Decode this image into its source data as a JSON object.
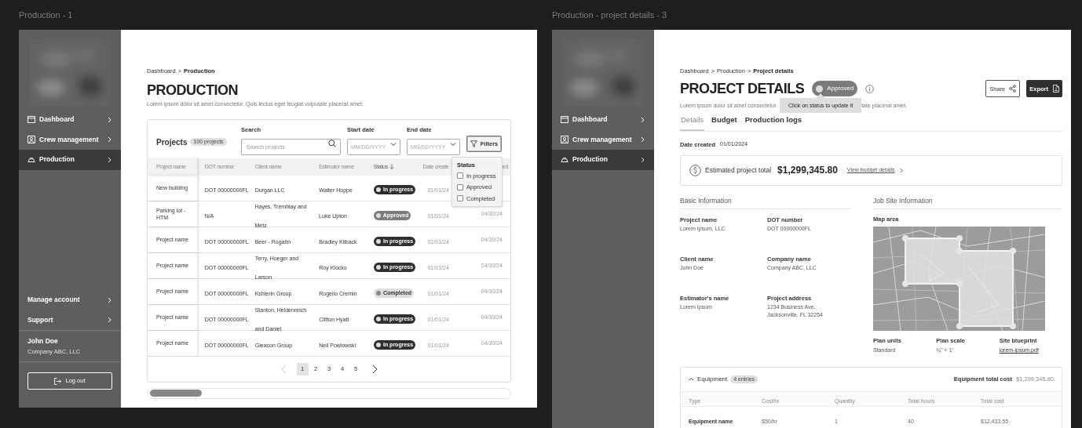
{
  "production_frame": {
    "title": "Production - 1",
    "sidebar": {
      "nav": [
        {
          "label": "Dashboard",
          "selected": false
        },
        {
          "label": "Crew management",
          "selected": false
        },
        {
          "label": "Production",
          "selected": true
        }
      ],
      "footer_nav": [
        {
          "label": "Manage account"
        },
        {
          "label": "Support"
        }
      ],
      "user": {
        "name": "John Doe",
        "company": "Company ABC, LLC"
      },
      "logout": "Log out"
    },
    "breadcrumb": [
      {
        "label": "Dashboard",
        "current": false
      },
      {
        "label": "Production",
        "current": true
      }
    ],
    "breadcrumb_separator": ">",
    "heading": "PRODUCTION",
    "subtitle": "Lorem ipsum dolor sit amet consectetur. Quis lectus eget feugiat vulputate placerat amet.",
    "projects": {
      "title": "Projects",
      "count": "100 projects",
      "search": {
        "label": "Search",
        "placeholder": "Search projects"
      },
      "start_date": {
        "label": "Start date",
        "placeholder": "MM/DD/YYYY"
      },
      "end_date": {
        "label": "End date",
        "placeholder": "MM/DD/YYYY"
      },
      "filters_button": "Filters",
      "columns": [
        {
          "label": "Project name",
          "sorted": false
        },
        {
          "label": "DOT number",
          "sorted": false
        },
        {
          "label": "Client name",
          "sorted": false
        },
        {
          "label": "Estimator name",
          "sorted": false
        },
        {
          "label": "Status",
          "sorted": true
        },
        {
          "label": "Date create",
          "sorted": false
        },
        {
          "label": "ed",
          "sorted": false
        }
      ],
      "rows": [
        {
          "name": "New building",
          "dot": "DOT 00000000FL",
          "client": "Durgan LLC",
          "estimator": "Walter Hoppe",
          "status": {
            "label": "In progress",
            "kind": "in_progress"
          },
          "start": "01/01/24"
        },
        {
          "name": "Parking lot - HTM",
          "dot": "N/A",
          "client": "Hayes, Tremblay and Metz",
          "estimator": "Luke Upton",
          "status": {
            "label": "Approved",
            "kind": "approved"
          },
          "start": "01/01/24",
          "end": "04/30/24"
        },
        {
          "name": "Project name",
          "dot": "DOT 00000000FL",
          "client": "Beer - Rogahn",
          "estimator": "Bradley Kilback",
          "status": {
            "label": "In progress",
            "kind": "in_progress"
          },
          "start": "01/01/24",
          "end": "04/30/24"
        },
        {
          "name": "Project name",
          "dot": "DOT 00000000FL",
          "client": "Terry, Hoeger and Larson",
          "estimator": "Roy Klocko",
          "status": {
            "label": "In progress",
            "kind": "in_progress"
          },
          "start": "01/01/24",
          "end": "04/30/24"
        },
        {
          "name": "Project name",
          "dot": "DOT 00000000FL",
          "client": "Kshlerin Group",
          "estimator": "Rogelio Cremin",
          "status": {
            "label": "Completed",
            "kind": "completed"
          },
          "start": "01/01/24",
          "end": "04/30/24"
        },
        {
          "name": "Project name",
          "dot": "DOT 00000000FL",
          "client": "Stanton, Heidenreich and Daniel",
          "estimator": "Clifton Hyatt",
          "status": {
            "label": "In progress",
            "kind": "in_progress"
          },
          "start": "01/01/24",
          "end": "04/30/24"
        },
        {
          "name": "Project name",
          "dot": "DOT 00000000FL",
          "client": "Gleason Group",
          "estimator": "Neil Powlowski",
          "status": {
            "label": "In progress",
            "kind": "in_progress"
          },
          "start": "01/01/24",
          "end": "04/30/24"
        }
      ],
      "pagination": [
        {
          "label": "1",
          "selected": true
        },
        {
          "label": "2",
          "selected": false
        },
        {
          "label": "3",
          "selected": false
        },
        {
          "label": "4",
          "selected": false
        },
        {
          "label": "5",
          "selected": false
        }
      ],
      "filter_popup": {
        "title": "Status",
        "options": [
          {
            "label": "In progress",
            "checked": false
          },
          {
            "label": "Approved",
            "checked": false
          },
          {
            "label": "Completed",
            "checked": false
          }
        ]
      }
    }
  },
  "details_frame": {
    "title": "Production - project details - 3",
    "sidebar": {
      "nav": [
        {
          "label": "Dashboard",
          "selected": false
        },
        {
          "label": "Crew management",
          "selected": false
        },
        {
          "label": "Production",
          "selected": true
        }
      ]
    },
    "breadcrumb": [
      {
        "label": "Dashboard",
        "current": false
      },
      {
        "label": "Production",
        "current": false
      },
      {
        "label": "Project details",
        "current": true
      }
    ],
    "breadcrumb_separator": ">",
    "heading": "PROJECT DETAILS",
    "status": {
      "label": "Approved",
      "kind": "approved"
    },
    "tooltip": "Click on status to update it",
    "subtitle_parts": [
      "Lorem ipsum dolor sit amet consectetur.",
      "tate placerat amet."
    ],
    "actions": [
      "Share",
      "Export"
    ],
    "tabs": [
      {
        "label": "Details",
        "selected": true
      },
      {
        "label": "Budget",
        "selected": false
      },
      {
        "label": "Production logs",
        "selected": false
      }
    ],
    "date_created": {
      "label": "Date created",
      "value": "01/01/2024"
    },
    "estimate": {
      "label": "Estimated project total",
      "amount": "$1,299,345.80",
      "link": "View budget details"
    },
    "basic_info": {
      "title": "Basic Information",
      "fields": [
        {
          "label": "Project name",
          "value": "Lorem Ipsum, LLC"
        },
        {
          "label": "DOT number",
          "value": "DOT 00000000FL"
        },
        {
          "label": "Client name",
          "value": "John Doe"
        },
        {
          "label": "Company name",
          "value": "Company ABC, LLC"
        },
        {
          "label": "Estimator's name",
          "value": "Lorem Ipsum"
        },
        {
          "label": "Project address",
          "value": "1234 Business Ave, Jacksonville, FL 32254"
        }
      ]
    },
    "job_site": {
      "title": "Job Site Information",
      "map_label": "Map area",
      "details": [
        {
          "label": "Plan units",
          "value": "Standard",
          "kind": "text"
        },
        {
          "label": "Plan scale",
          "value": "¼\" = 1'",
          "kind": "text"
        },
        {
          "label": "Site blueprint",
          "value": "lorem-ipsum.pdf",
          "kind": "link"
        }
      ]
    },
    "equipment": {
      "title": "Equipment",
      "count": "4 entries",
      "expanded": true,
      "total_label": "Equipment total cost",
      "total_value": "$1,299,345.80",
      "columns": [
        "Type",
        "Cost/hr",
        "Quantity",
        "Total hours",
        "Total cost"
      ],
      "rows": [
        [
          "Equipment name",
          "$50/hr",
          "1",
          "40",
          "$12,433.55"
        ]
      ]
    }
  }
}
